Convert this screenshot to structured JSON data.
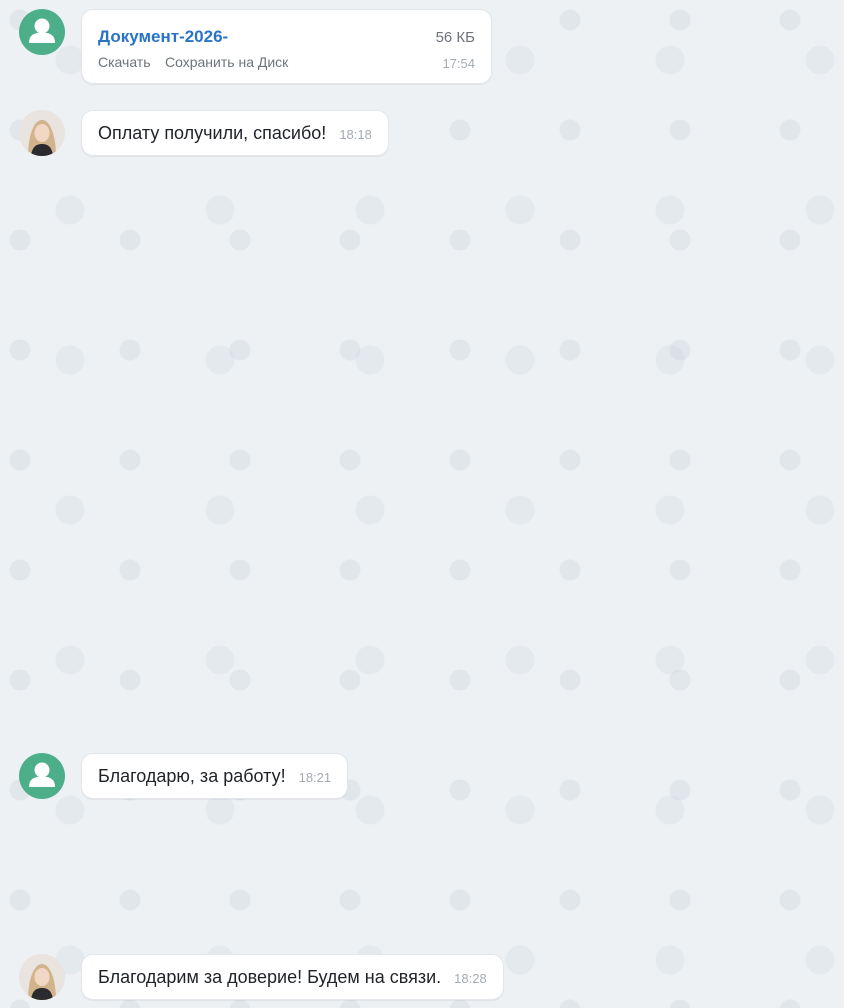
{
  "messages": [
    {
      "type": "file",
      "avatar": "default-user-icon",
      "file_name": "Документ-2026-",
      "file_size": "56 КБ",
      "download_label": "Скачать",
      "save_label": "Сохранить на Диск",
      "time": "17:54"
    },
    {
      "type": "text",
      "avatar": "photo",
      "text": "Оплату получили, спасибо!",
      "time": "18:18"
    },
    {
      "type": "text",
      "avatar": "default-user-icon",
      "text": "Благодарю, за работу!",
      "time": "18:21"
    },
    {
      "type": "text",
      "avatar": "photo",
      "text": "Благодарим за доверие! Будем на связи.",
      "time": "18:28"
    }
  ],
  "colors": {
    "background": "#eef1f4",
    "link": "#2874c5",
    "default_avatar": "#4caf8a",
    "bubble": "#ffffff",
    "time": "#a4abb3"
  }
}
